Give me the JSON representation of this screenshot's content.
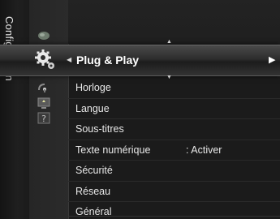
{
  "sidebar": {
    "category_label": "Configuration",
    "icons": [
      "picture-icon",
      "setup-gear-icon",
      "satellite-dish-icon",
      "input-icon",
      "support-icon"
    ]
  },
  "selected": {
    "label": "Plug & Play",
    "left_arrow": "◀",
    "right_arrow": "▶",
    "scroll_up": "▲",
    "scroll_down": "▼"
  },
  "menu": {
    "items": [
      {
        "label": "Horloge",
        "value": ""
      },
      {
        "label": "Langue",
        "value": ""
      },
      {
        "label": "Sous-titres",
        "value": ""
      },
      {
        "label": "Texte numérique",
        "value": ": Activer"
      },
      {
        "label": "Sécurité",
        "value": ""
      },
      {
        "label": "Réseau",
        "value": ""
      },
      {
        "label": "Général",
        "value": ""
      }
    ]
  }
}
